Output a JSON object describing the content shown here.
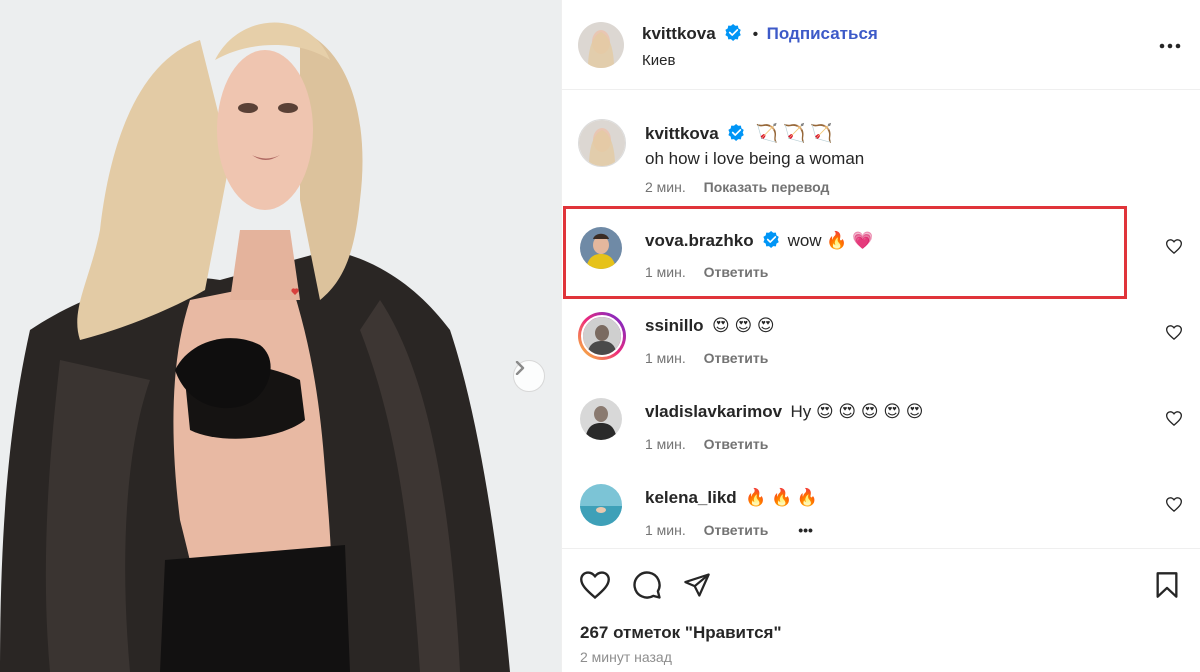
{
  "post": {
    "author": "kvittkova",
    "follow_label": "Подписаться",
    "location": "Киев",
    "more_icon": "more-horizontal-icon"
  },
  "caption": {
    "username": "kvittkova",
    "emoji": "🏹 🏹 🏹",
    "text": "oh how i love being a woman",
    "time": "2 мин.",
    "translate_label": "Показать перевод"
  },
  "comments": [
    {
      "username": "vova.brazhko",
      "verified": true,
      "text": "wow 🔥 💗",
      "time": "1 мин.",
      "reply_label": "Ответить",
      "highlighted": true
    },
    {
      "username": "ssinillo",
      "verified": false,
      "text": "😍 😍 😍",
      "time": "1 мин.",
      "reply_label": "Ответить"
    },
    {
      "username": "vladislavkarimov",
      "verified": false,
      "text": "Ну 😍 😍 😍 😍 😍",
      "time": "1 мин.",
      "reply_label": "Ответить"
    },
    {
      "username": "kelena_likd",
      "verified": false,
      "text": "🔥 🔥 🔥",
      "time": "1 мин.",
      "reply_label": "Ответить",
      "more": "•••"
    }
  ],
  "footer": {
    "likes": "267 отметок \"Нравится\"",
    "posted": "2 минут назад"
  },
  "colors": {
    "verified": "#0095f6",
    "highlight": "#e0343a",
    "follow": "#3d5ac8"
  }
}
